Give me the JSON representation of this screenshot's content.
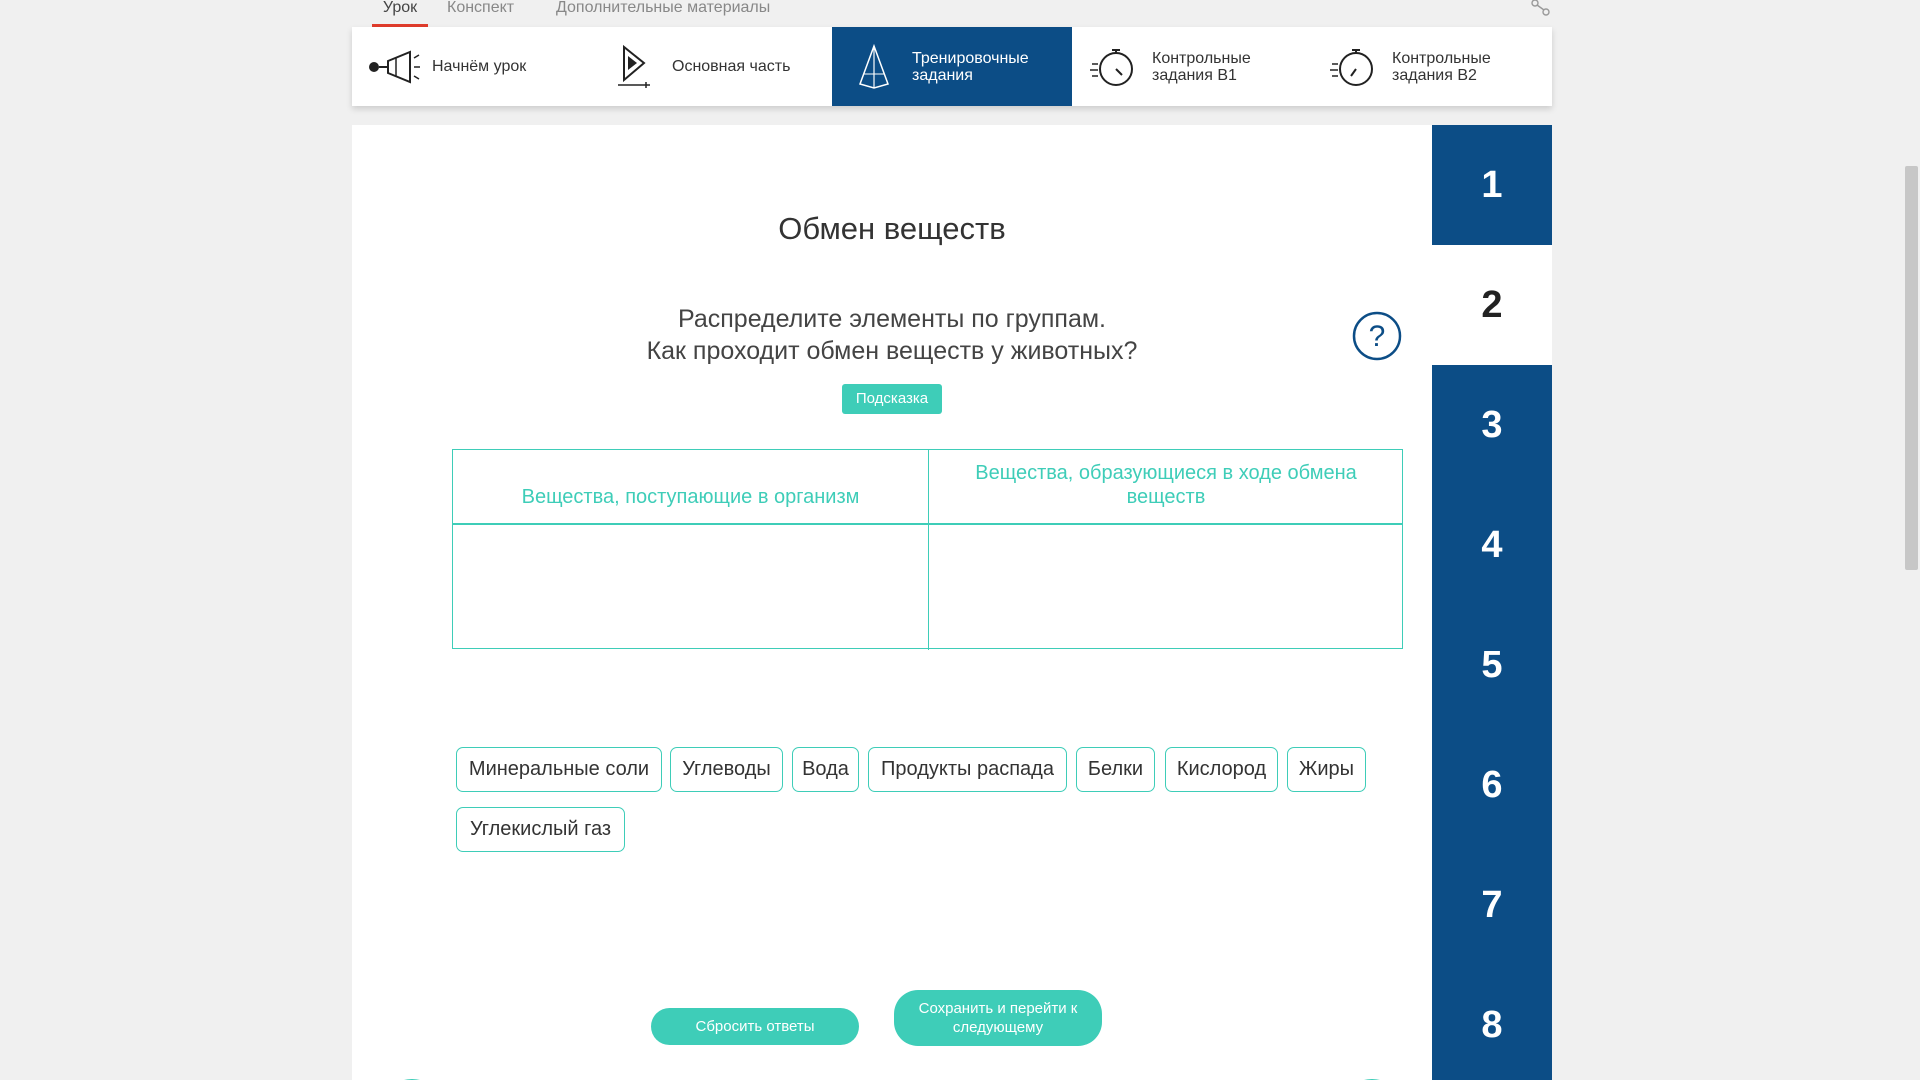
{
  "tabs": [
    {
      "label": "Урок",
      "active": true
    },
    {
      "label": "Конспект",
      "active": false
    },
    {
      "label": "Дополнительные материалы",
      "active": false
    }
  ],
  "sections": [
    {
      "label": "Начнём урок",
      "icon": "megaphone-icon",
      "active": false
    },
    {
      "label": "Основная часть",
      "icon": "play-icon",
      "active": false
    },
    {
      "label": "Тренировочные задания",
      "icon": "pyramid-icon",
      "active": true
    },
    {
      "label": "Контрольные задания В1",
      "icon": "stopwatch-icon",
      "active": false
    },
    {
      "label": "Контрольные задания В2",
      "icon": "stopwatch-icon",
      "active": false
    }
  ],
  "task": {
    "title": "Обмен веществ",
    "question_line1": "Распределите элементы по группам.",
    "question_line2": "Как проходит обмен веществ у животных?",
    "hint_label": "Подсказка",
    "col1_header": "Вещества, поступающие в организм",
    "col2_header": "Вещества, образующиеся в ходе обмена веществ",
    "chips": [
      "Минеральные соли",
      "Углеводы",
      "Вода",
      "Продукты распада",
      "Белки",
      "Кислород",
      "Жиры",
      "Углекислый газ"
    ],
    "reset_label": "Сбросить ответы",
    "save_label": "Сохранить и перейти к следующему"
  },
  "task_numbers": [
    "1",
    "2",
    "3",
    "4",
    "5",
    "6",
    "7",
    "8"
  ],
  "active_task": "2",
  "colors": {
    "accent": "#3ecdb8",
    "navy": "#0c4d86",
    "tab_underline": "#e03c2c"
  }
}
